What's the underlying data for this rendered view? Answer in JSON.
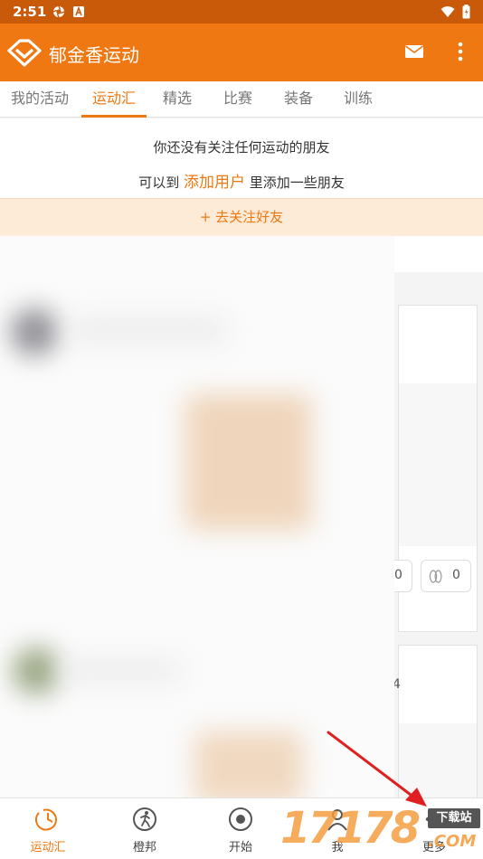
{
  "status_bar": {
    "time": "2:51"
  },
  "app_bar": {
    "title": "郁金香运动"
  },
  "tabs": [
    {
      "label": "我的活动"
    },
    {
      "label": "运动汇"
    },
    {
      "label": "精选"
    },
    {
      "label": "比赛"
    },
    {
      "label": "装备"
    },
    {
      "label": "训练"
    }
  ],
  "notice": {
    "line1": "你还没有关注任何运动的朋友",
    "line2_prefix": "可以到",
    "line2_link": "添加用户",
    "line2_suffix": "里添加一些朋友"
  },
  "follow_button": {
    "label": "+ 去关注好友"
  },
  "feed": {
    "card_stats": [
      "0",
      "0"
    ],
    "side_digit": "4"
  },
  "bottom_nav": [
    {
      "label": "运动汇",
      "icon": "clock-icon"
    },
    {
      "label": "橙邦",
      "icon": "runner-icon"
    },
    {
      "label": "开始",
      "icon": "record-icon"
    },
    {
      "label": "我",
      "icon": "person-icon"
    },
    {
      "label": "更多",
      "icon": "more-icon"
    }
  ],
  "watermark": {
    "digits": "17178",
    "badge": "下载站",
    "suffix": ".COM"
  },
  "colors": {
    "primary": "#f07812",
    "status_bar": "#c85a0a",
    "follow_bg": "#fdebd8"
  }
}
